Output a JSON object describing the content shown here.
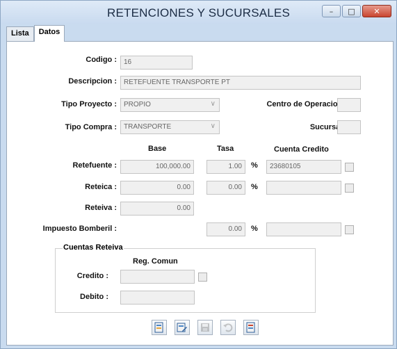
{
  "window": {
    "title": "RETENCIONES Y SUCURSALES",
    "minimize": "–",
    "maximize": "□",
    "close": "✕"
  },
  "tabs": [
    {
      "label": "Lista"
    },
    {
      "label": "Datos"
    }
  ],
  "form": {
    "codigo_label": "Codigo :",
    "codigo_value": "16",
    "descripcion_label": "Descripcion :",
    "descripcion_value": "RETEFUENTE TRANSPORTE PT",
    "tipo_proyecto_label": "Tipo Proyecto :",
    "tipo_proyecto_value": "PROPIO",
    "centro_operacion_label": "Centro de Operacion :",
    "centro_operacion_value": "",
    "tipo_compra_label": "Tipo Compra :",
    "tipo_compra_value": "TRANSPORTE",
    "sucursal_label": "Sucursal :",
    "sucursal_value": ""
  },
  "retenciones": {
    "headers": {
      "base": "Base",
      "tasa": "Tasa",
      "cuenta": "Cuenta Credito"
    },
    "pct_symbol": "%",
    "rows": [
      {
        "label": "Retefuente :",
        "base": "100,000.00",
        "tasa": "1.00",
        "cuenta": "23680105"
      },
      {
        "label": "Reteica :",
        "base": "0.00",
        "tasa": "0.00",
        "cuenta": ""
      },
      {
        "label": "Reteiva :",
        "base": "0.00"
      },
      {
        "label": "Impuesto Bomberil :",
        "tasa": "0.00",
        "cuenta": ""
      }
    ]
  },
  "cuentas_reteiva": {
    "title": "Cuentas Reteiva",
    "header": "Reg. Comun",
    "credito_label": "Credito :",
    "credito_value": "",
    "debito_label": "Debito :",
    "debito_value": ""
  },
  "toolbar": [
    {
      "icon": "new-record-icon",
      "enabled": true
    },
    {
      "icon": "edit-record-icon",
      "enabled": true
    },
    {
      "icon": "save-icon",
      "enabled": false
    },
    {
      "icon": "undo-icon",
      "enabled": false
    },
    {
      "icon": "exit-icon",
      "enabled": true
    }
  ]
}
